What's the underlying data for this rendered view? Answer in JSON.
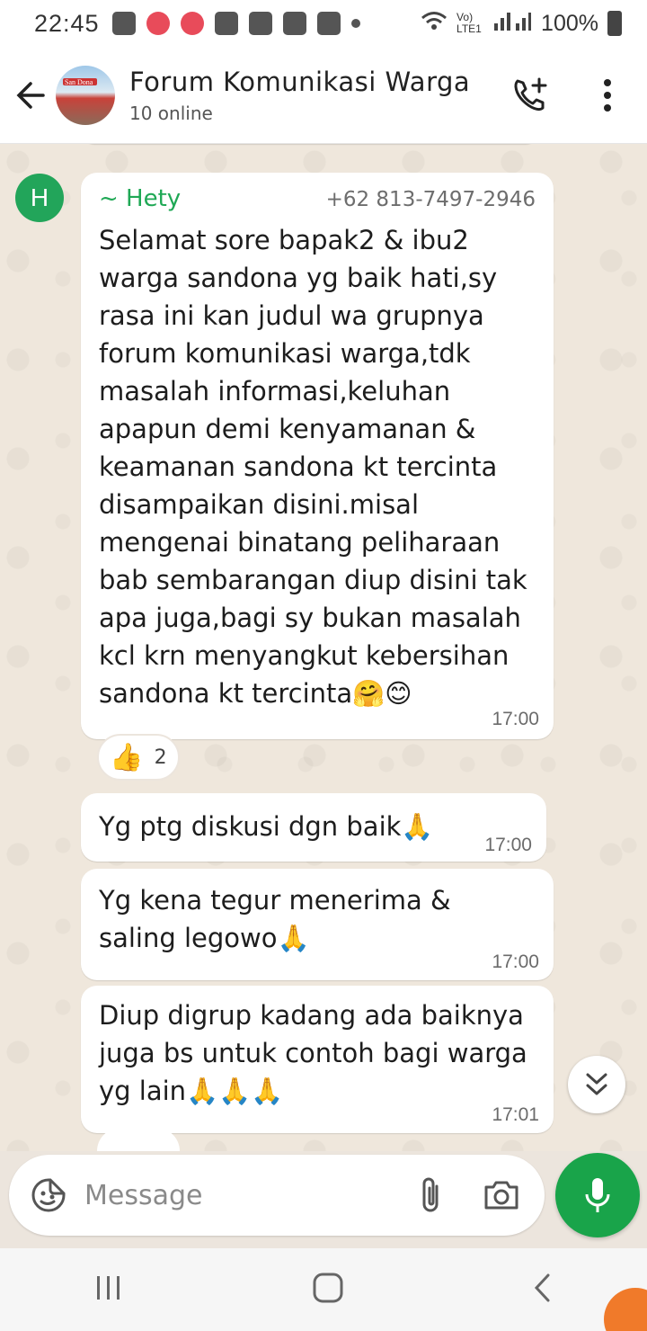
{
  "status_bar": {
    "time": "22:45",
    "network": "Vo) LTE1",
    "battery": "100%"
  },
  "header": {
    "title": "Forum Komunikasi Warga",
    "subtitle": "10 online",
    "avatar_text": "San Dona",
    "icons": {
      "back": "back-arrow-icon",
      "add_call": "add-call-icon",
      "more": "more-vert-icon"
    }
  },
  "messages": [
    {
      "avatar_letter": "H",
      "sender": "~ Hety",
      "phone": "+62 813-7497-2946",
      "text": "Selamat sore bapak2 & ibu2\nwarga sandona yg baik hati,sy\nrasa ini kan judul wa grupnya\nforum komunikasi warga,tdk\nmasalah informasi,keluhan\napapun demi kenyamanan &\nkeamanan sandona kt tercinta\ndisampaikan disini.misal\nmengenai binatang peliharaan\nbab sembarangan diup disini tak\napa juga,bagi sy bukan masalah\nkcl krn menyangkut kebersihan\nsandona kt tercinta🤗😊",
      "time": "17:00",
      "reaction": {
        "emoji": "👍",
        "count": "2"
      }
    },
    {
      "text": "Yg ptg diskusi dgn baik🙏",
      "time": "17:00"
    },
    {
      "text": "Yg kena tegur menerima &\nsaling legowo🙏",
      "time": "17:00"
    },
    {
      "text": "Diup digrup kadang ada baiknya\njuga bs untuk contoh bagi warga\nyg lain🙏🙏🙏",
      "time": "17:01"
    }
  ],
  "input": {
    "placeholder": "Message",
    "icons": {
      "sticker": "sticker-icon",
      "attach": "paperclip-icon",
      "camera": "camera-icon",
      "mic": "mic-icon",
      "scroll_down": "chevron-double-down-icon"
    }
  },
  "colors": {
    "accent": "#19a44a",
    "sender_name": "#1fa855",
    "chat_bg": "#efe7dc"
  }
}
